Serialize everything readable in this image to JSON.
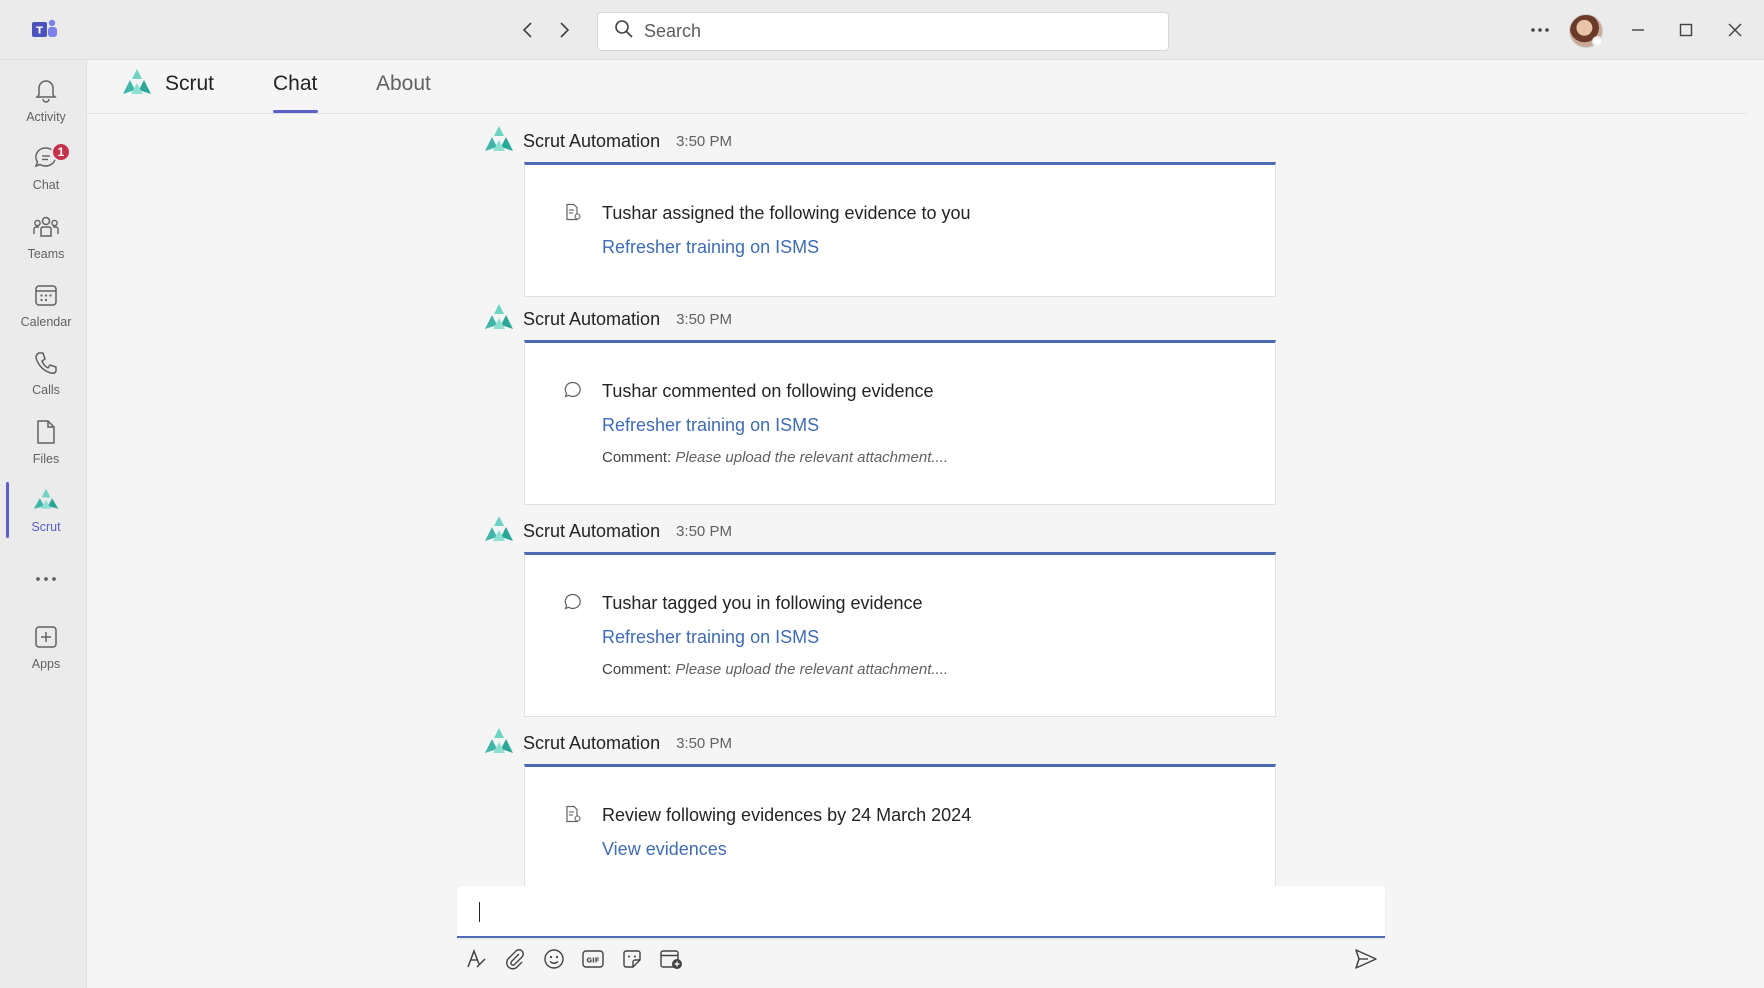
{
  "titlebar": {
    "search_placeholder": "Search",
    "icons": [
      "back-icon",
      "forward-icon",
      "search-icon",
      "more-icon",
      "minimize-icon",
      "maximize-icon",
      "close-icon"
    ]
  },
  "rail": {
    "items": [
      {
        "label": "Activity",
        "icon": "bell-icon"
      },
      {
        "label": "Chat",
        "icon": "chat-icon",
        "badge": "1"
      },
      {
        "label": "Teams",
        "icon": "teams-icon"
      },
      {
        "label": "Calendar",
        "icon": "calendar-icon"
      },
      {
        "label": "Calls",
        "icon": "phone-icon"
      },
      {
        "label": "Files",
        "icon": "file-icon"
      },
      {
        "label": "Scrut",
        "icon": "scrut-icon",
        "active": true
      },
      {
        "label": "",
        "icon": "more-icon"
      },
      {
        "label": "Apps",
        "icon": "add-app-icon"
      }
    ]
  },
  "app": {
    "name": "Scrut",
    "tabs": [
      {
        "label": "Chat",
        "active": true
      },
      {
        "label": "About",
        "active": false
      }
    ]
  },
  "messages": [
    {
      "sender": "Scrut Automation",
      "time": "3:50 PM",
      "icon": "document-icon",
      "title": "Tushar assigned the following evidence to you",
      "link": "Refresher training on ISMS",
      "comment_label": "",
      "comment_text": ""
    },
    {
      "sender": "Scrut Automation",
      "time": "3:50 PM",
      "icon": "comment-icon",
      "title": "Tushar commented on following evidence",
      "link": "Refresher training on ISMS",
      "comment_label": "Comment:",
      "comment_text": "Please upload the relevant attachment...."
    },
    {
      "sender": "Scrut Automation",
      "time": "3:50 PM",
      "icon": "comment-icon",
      "title": "Tushar tagged you in following evidence",
      "link": "Refresher training on ISMS",
      "comment_label": "Comment:",
      "comment_text": "Please upload the relevant attachment...."
    },
    {
      "sender": "Scrut Automation",
      "time": "3:50 PM",
      "icon": "document-icon",
      "title": "Review following evidences by 24 March 2024",
      "link": "View evidences",
      "comment_label": "",
      "comment_text": ""
    }
  ],
  "composer": {
    "value": "",
    "tools": [
      "format-icon",
      "attach-icon",
      "emoji-icon",
      "gif-icon",
      "sticker-icon",
      "schedule-meeting-icon",
      "send-icon"
    ]
  },
  "colors": {
    "accent": "#5b5fc7",
    "card_border": "#4f6bb5",
    "link": "#3f6cb3",
    "scrut_teal": "#3fc1b0",
    "badge": "#c4314b"
  }
}
